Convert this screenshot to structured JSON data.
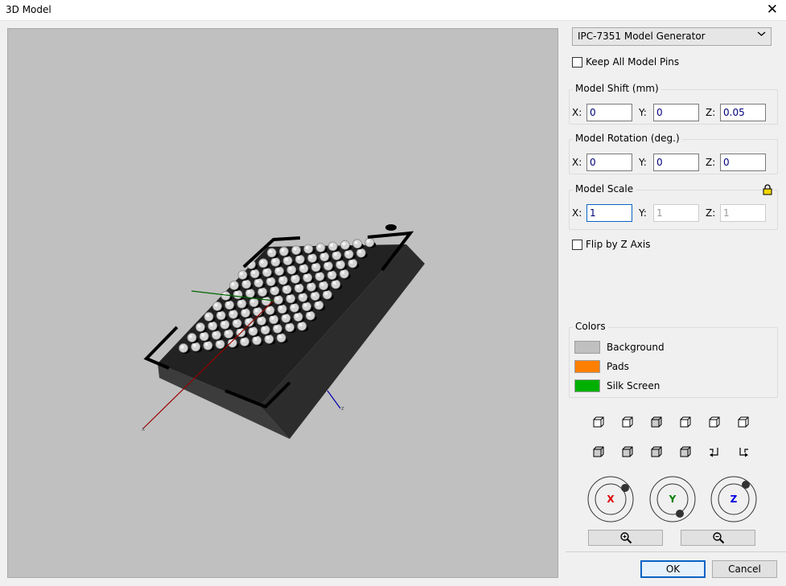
{
  "window": {
    "title": "3D Model",
    "close_glyph": "✕"
  },
  "generator": {
    "selected": "IPC-7351 Model Generator"
  },
  "keep_pins": {
    "label": "Keep All Model Pins",
    "checked": false
  },
  "shift": {
    "title": "Model Shift (mm)",
    "x_label": "X:",
    "y_label": "Y:",
    "z_label": "Z:",
    "x": "0",
    "y": "0",
    "z": "0.05"
  },
  "rotation": {
    "title": "Model Rotation (deg.)",
    "x_label": "X:",
    "y_label": "Y:",
    "z_label": "Z:",
    "x": "0",
    "y": "0",
    "z": "0"
  },
  "scale": {
    "title": "Model Scale",
    "x_label": "X:",
    "y_label": "Y:",
    "z_label": "Z:",
    "x": "1",
    "y": "1",
    "z": "1",
    "locked": true
  },
  "flip": {
    "label": "Flip by Z Axis",
    "checked": false
  },
  "colors": {
    "title": "Colors",
    "items": [
      {
        "label": "Background",
        "color": "#c0c0c0"
      },
      {
        "label": "Pads",
        "color": "#ff8000"
      },
      {
        "label": "Silk Screen",
        "color": "#00b000"
      }
    ]
  },
  "orbit": {
    "x": "X",
    "y": "Y",
    "z": "Z",
    "x_color": "#e00000",
    "y_color": "#008000",
    "z_color": "#0000e0"
  },
  "view_icons": [
    "view-front-icon",
    "view-back-icon",
    "view-top-icon",
    "view-bottom-icon",
    "view-left-icon",
    "view-right-icon",
    "iso-view-1-icon",
    "iso-view-2-icon",
    "iso-view-3-icon",
    "iso-view-4-icon",
    "rotate-ccw-icon",
    "rotate-cw-icon"
  ],
  "buttons": {
    "ok": "OK",
    "cancel": "Cancel"
  }
}
